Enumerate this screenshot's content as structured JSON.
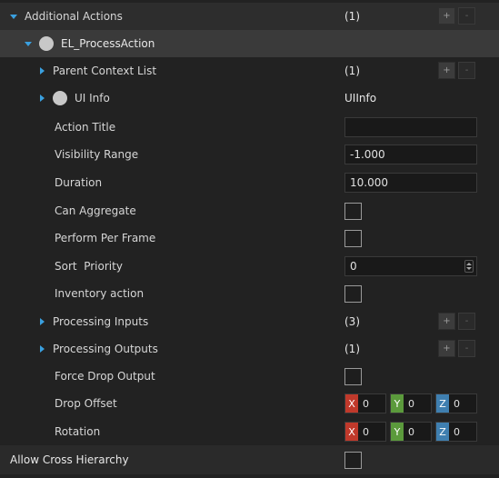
{
  "colors": {
    "accent": "#3aa0e0",
    "x_axis": "#c0392b",
    "y_axis": "#5b9a3c",
    "z_axis": "#3f7fb0"
  },
  "additional_actions": {
    "label": "Additional Actions",
    "count": "(1)",
    "add": "+",
    "remove": "-"
  },
  "process_action": {
    "label": "EL_ProcessAction"
  },
  "parent_context_list": {
    "label": "Parent Context List",
    "count": "(1)",
    "add": "+",
    "remove": "-"
  },
  "ui_info": {
    "label": "UI Info",
    "value": "UIInfo"
  },
  "action_title": {
    "label": "Action Title",
    "value": ""
  },
  "visibility_range": {
    "label": "Visibility Range",
    "value": "-1.000"
  },
  "duration": {
    "label": "Duration",
    "value": "10.000"
  },
  "can_aggregate": {
    "label": "Can Aggregate",
    "checked": false
  },
  "perform_per_frame": {
    "label": "Perform Per Frame",
    "checked": false
  },
  "sort_priority": {
    "label": "Sort  Priority",
    "value": "0"
  },
  "inventory_action": {
    "label": "Inventory action",
    "checked": false
  },
  "processing_inputs": {
    "label": "Processing Inputs",
    "count": "(3)",
    "add": "+",
    "remove": "-"
  },
  "processing_outputs": {
    "label": "Processing Outputs",
    "count": "(1)",
    "add": "+",
    "remove": "-"
  },
  "force_drop_output": {
    "label": "Force Drop Output",
    "checked": false
  },
  "drop_offset": {
    "label": "Drop Offset",
    "x_label": "X",
    "x": "0",
    "y_label": "Y",
    "y": "0",
    "z_label": "Z",
    "z": "0"
  },
  "rotation": {
    "label": "Rotation",
    "x_label": "X",
    "x": "0",
    "y_label": "Y",
    "y": "0",
    "z_label": "Z",
    "z": "0"
  },
  "allow_cross_hierarchy": {
    "label": "Allow Cross Hierarchy",
    "checked": false
  }
}
